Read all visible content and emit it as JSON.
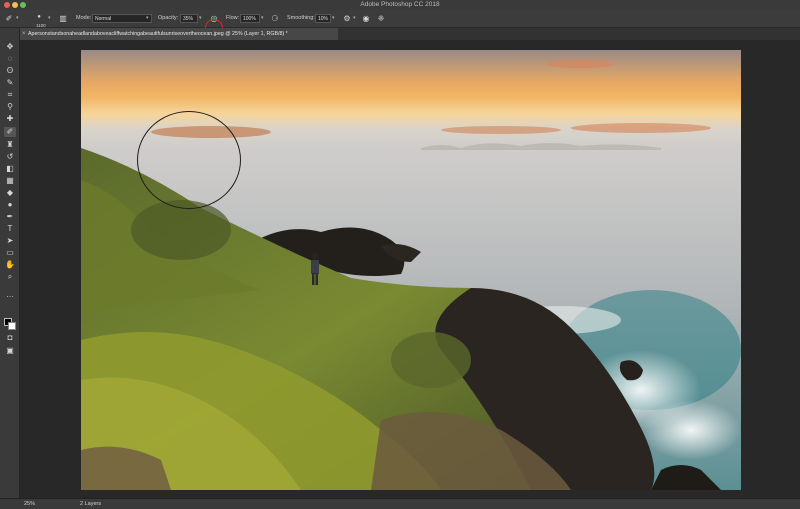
{
  "app": {
    "title": "Adobe Photoshop CC 2018"
  },
  "options_bar": {
    "brush_size": "1100",
    "mode_label": "Mode:",
    "mode_value": "Normal",
    "opacity_label": "Opacity:",
    "opacity_value": "35%",
    "flow_label": "Flow:",
    "flow_value": "100%",
    "smoothing_label": "Smoothing:",
    "smoothing_value": "10%"
  },
  "document": {
    "tab_title": "Apersonstandsonaheadlandaboveacliffwatchingabeautifulsunriseovertheocean.jpeg @ 25% (Layer 1, RGB/8) *",
    "tab_close": "×"
  },
  "status": {
    "zoom": "25%",
    "info": "2 Layers"
  },
  "colors": {
    "foreground": "#000000",
    "background": "#ffffff",
    "highlight_ring": "#e02424"
  },
  "icons": {
    "close": "×",
    "move": "✥",
    "marquee": "◌",
    "lasso": "ʘ",
    "quick-select": "✎",
    "crop": "⌗",
    "eyedropper": "⚲",
    "healing": "✚",
    "brush": "✐",
    "stamp": "♜",
    "history-brush": "↺",
    "eraser": "◧",
    "gradient": "▦",
    "blur": "◆",
    "dodge": "●",
    "pen": "✒",
    "type": "T",
    "path-select": "➤",
    "shape": "▭",
    "hand": "✋",
    "zoom": "⌕",
    "more": "…",
    "quick-mask": "◘",
    "screen-mode": "▣",
    "toggle-panel": "▥",
    "pressure-opacity": "◎",
    "settings": "⚙",
    "pressure-size": "◉",
    "symmetry": "❈",
    "airbrush": "⚆",
    "flow-icon": "↯",
    "brush-tool": "✐"
  }
}
